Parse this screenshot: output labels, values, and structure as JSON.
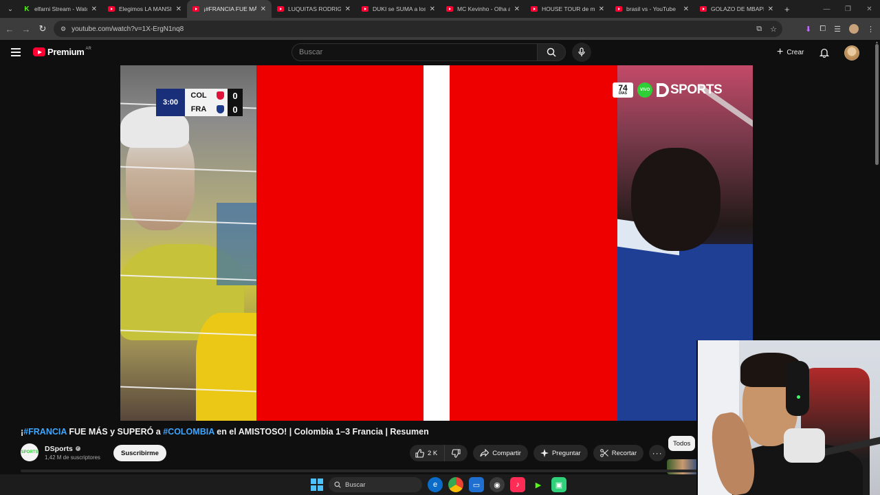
{
  "browser": {
    "tabs": [
      {
        "title": "elfarni Stream - Watc",
        "favicon": "kick-icon",
        "active": false
      },
      {
        "title": "Elegimos LA MANSIÓ",
        "favicon": "youtube-icon",
        "active": false
      },
      {
        "title": "¡#FRANCIA FUE MÁS",
        "favicon": "youtube-icon",
        "active": true
      },
      {
        "title": "LUQUITAS RODRIGUE",
        "favicon": "youtube-icon",
        "active": false
      },
      {
        "title": "DUKI se SUMA a los T",
        "favicon": "youtube-icon",
        "active": false
      },
      {
        "title": "MC Kevinho - Olha a",
        "favicon": "youtube-icon",
        "active": false
      },
      {
        "title": "HOUSE TOUR de mi",
        "favicon": "youtube-icon",
        "active": false
      },
      {
        "title": "brasil vs - YouTube",
        "favicon": "youtube-icon",
        "active": false
      },
      {
        "title": "GOLAZO DE MBAPPE",
        "favicon": "youtube-icon",
        "active": false
      }
    ],
    "url": "youtube.com/watch?v=1X-ErgN1nq8"
  },
  "youtube": {
    "logo_text": "Premium",
    "country_code": "AR",
    "search_placeholder": "Buscar",
    "create_label": "Crear"
  },
  "video": {
    "scoreboard": {
      "clock": "3:00",
      "teams": [
        {
          "name": "COL",
          "goals": "0",
          "crest_color": "#e0123a"
        },
        {
          "name": "FRA",
          "goals": "0",
          "crest_color": "#1d3a8a"
        }
      ]
    },
    "broadcaster": {
      "days_number": "74",
      "days_label": "DÍAS",
      "live_label": "VIVO",
      "name": "SPORTS"
    }
  },
  "info": {
    "title_parts": {
      "prefix": "¡",
      "tag1": "#FRANCIA",
      "mid1": " FUE MÁS y SUPERÓ a ",
      "tag2": "#COLOMBIA",
      "rest": " en el AMISTOSO! | Colombia 1–3 Francia | Resumen"
    },
    "channel": {
      "name": "DSports",
      "subscribers": "1,42 M de suscriptores",
      "avatar_text": "SPORTS"
    },
    "subscribe_label": "Suscribirme",
    "likes": "2 K",
    "share_label": "Compartir",
    "ask_label": "Preguntar",
    "clip_label": "Recortar",
    "filter_chip": "Todos"
  },
  "taskbar": {
    "search_label": "Buscar"
  }
}
